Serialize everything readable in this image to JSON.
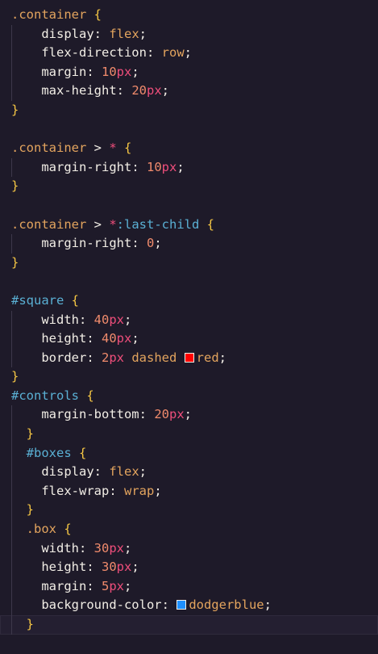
{
  "editor": {
    "colors": {
      "background": "#1e1a29",
      "selector": "#e3a45e",
      "id_selector": "#5ab0d4",
      "brace": "#f6c744",
      "property": "#f2eee6",
      "number": "#f08b6c",
      "unit": "#ef4e7b"
    },
    "lines": [
      {
        "tokens": [
          {
            "t": "sel",
            "v": ".container"
          },
          {
            "t": "punct",
            "v": " "
          },
          {
            "t": "brace",
            "v": "{"
          }
        ]
      },
      {
        "indent": 1,
        "tokens": [
          {
            "t": "prop",
            "v": "display"
          },
          {
            "t": "punct",
            "v": ": "
          },
          {
            "t": "kw",
            "v": "flex"
          },
          {
            "t": "punct",
            "v": ";"
          }
        ]
      },
      {
        "indent": 1,
        "tokens": [
          {
            "t": "prop",
            "v": "flex-direction"
          },
          {
            "t": "punct",
            "v": ": "
          },
          {
            "t": "kw",
            "v": "row"
          },
          {
            "t": "punct",
            "v": ";"
          }
        ]
      },
      {
        "indent": 1,
        "tokens": [
          {
            "t": "prop",
            "v": "margin"
          },
          {
            "t": "punct",
            "v": ": "
          },
          {
            "t": "num",
            "v": "10"
          },
          {
            "t": "unit",
            "v": "px"
          },
          {
            "t": "punct",
            "v": ";"
          }
        ]
      },
      {
        "indent": 1,
        "tokens": [
          {
            "t": "prop",
            "v": "max-height"
          },
          {
            "t": "punct",
            "v": ": "
          },
          {
            "t": "num",
            "v": "20"
          },
          {
            "t": "unit",
            "v": "px"
          },
          {
            "t": "punct",
            "v": ";"
          }
        ]
      },
      {
        "tokens": [
          {
            "t": "brace",
            "v": "}"
          }
        ]
      },
      {
        "tokens": []
      },
      {
        "tokens": [
          {
            "t": "sel",
            "v": ".container"
          },
          {
            "t": "op",
            "v": " > "
          },
          {
            "t": "star",
            "v": "*"
          },
          {
            "t": "punct",
            "v": " "
          },
          {
            "t": "brace",
            "v": "{"
          }
        ]
      },
      {
        "indent": 1,
        "tokens": [
          {
            "t": "prop",
            "v": "margin-right"
          },
          {
            "t": "punct",
            "v": ": "
          },
          {
            "t": "num",
            "v": "10"
          },
          {
            "t": "unit",
            "v": "px"
          },
          {
            "t": "punct",
            "v": ";"
          }
        ]
      },
      {
        "tokens": [
          {
            "t": "brace",
            "v": "}"
          }
        ]
      },
      {
        "tokens": []
      },
      {
        "tokens": [
          {
            "t": "sel",
            "v": ".container"
          },
          {
            "t": "op",
            "v": " > "
          },
          {
            "t": "star",
            "v": "*"
          },
          {
            "t": "pseudo",
            "v": ":last-child"
          },
          {
            "t": "punct",
            "v": " "
          },
          {
            "t": "brace",
            "v": "{"
          }
        ]
      },
      {
        "indent": 1,
        "tokens": [
          {
            "t": "prop",
            "v": "margin-right"
          },
          {
            "t": "punct",
            "v": ": "
          },
          {
            "t": "num",
            "v": "0"
          },
          {
            "t": "punct",
            "v": ";"
          }
        ]
      },
      {
        "tokens": [
          {
            "t": "brace",
            "v": "}"
          }
        ]
      },
      {
        "tokens": []
      },
      {
        "tokens": [
          {
            "t": "idsel",
            "v": "#square"
          },
          {
            "t": "punct",
            "v": " "
          },
          {
            "t": "brace",
            "v": "{"
          }
        ]
      },
      {
        "indent": 1,
        "tokens": [
          {
            "t": "prop",
            "v": "width"
          },
          {
            "t": "punct",
            "v": ": "
          },
          {
            "t": "num",
            "v": "40"
          },
          {
            "t": "unit",
            "v": "px"
          },
          {
            "t": "punct",
            "v": ";"
          }
        ]
      },
      {
        "indent": 1,
        "tokens": [
          {
            "t": "prop",
            "v": "height"
          },
          {
            "t": "punct",
            "v": ": "
          },
          {
            "t": "num",
            "v": "40"
          },
          {
            "t": "unit",
            "v": "px"
          },
          {
            "t": "punct",
            "v": ";"
          }
        ]
      },
      {
        "indent": 1,
        "tokens": [
          {
            "t": "prop",
            "v": "border"
          },
          {
            "t": "punct",
            "v": ": "
          },
          {
            "t": "num",
            "v": "2"
          },
          {
            "t": "unit",
            "v": "px"
          },
          {
            "t": "kw",
            "v": " dashed "
          },
          {
            "t": "swatch",
            "v": "#ff0000"
          },
          {
            "t": "kw",
            "v": "red"
          },
          {
            "t": "punct",
            "v": ";"
          }
        ]
      },
      {
        "tokens": [
          {
            "t": "brace",
            "v": "}"
          }
        ]
      },
      {
        "tokens": [
          {
            "t": "idsel",
            "v": "#controls"
          },
          {
            "t": "punct",
            "v": " "
          },
          {
            "t": "brace",
            "v": "{"
          }
        ]
      },
      {
        "indent": 1,
        "tokens": [
          {
            "t": "prop",
            "v": "margin-bottom"
          },
          {
            "t": "punct",
            "v": ": "
          },
          {
            "t": "num",
            "v": "20"
          },
          {
            "t": "unit",
            "v": "px"
          },
          {
            "t": "punct",
            "v": ";"
          }
        ]
      },
      {
        "nested": 1,
        "tokens": [
          {
            "t": "brace",
            "v": "}"
          }
        ]
      },
      {
        "nested": 1,
        "tokens": [
          {
            "t": "idsel",
            "v": "#boxes"
          },
          {
            "t": "punct",
            "v": " "
          },
          {
            "t": "brace",
            "v": "{"
          }
        ]
      },
      {
        "indent": 1,
        "tokens": [
          {
            "t": "prop",
            "v": "display"
          },
          {
            "t": "punct",
            "v": ": "
          },
          {
            "t": "kw",
            "v": "flex"
          },
          {
            "t": "punct",
            "v": ";"
          }
        ]
      },
      {
        "indent": 1,
        "tokens": [
          {
            "t": "prop",
            "v": "flex-wrap"
          },
          {
            "t": "punct",
            "v": ": "
          },
          {
            "t": "kw",
            "v": "wrap"
          },
          {
            "t": "punct",
            "v": ";"
          }
        ]
      },
      {
        "nested": 1,
        "tokens": [
          {
            "t": "brace",
            "v": "}"
          }
        ]
      },
      {
        "nested": 1,
        "tokens": [
          {
            "t": "sel",
            "v": ".box"
          },
          {
            "t": "punct",
            "v": " "
          },
          {
            "t": "brace",
            "v": "{"
          }
        ]
      },
      {
        "indent": 1,
        "tokens": [
          {
            "t": "prop",
            "v": "width"
          },
          {
            "t": "punct",
            "v": ": "
          },
          {
            "t": "num",
            "v": "30"
          },
          {
            "t": "unit",
            "v": "px"
          },
          {
            "t": "punct",
            "v": ";"
          }
        ]
      },
      {
        "indent": 1,
        "tokens": [
          {
            "t": "prop",
            "v": "height"
          },
          {
            "t": "punct",
            "v": ": "
          },
          {
            "t": "num",
            "v": "30"
          },
          {
            "t": "unit",
            "v": "px"
          },
          {
            "t": "punct",
            "v": ";"
          }
        ]
      },
      {
        "indent": 1,
        "tokens": [
          {
            "t": "prop",
            "v": "margin"
          },
          {
            "t": "punct",
            "v": ": "
          },
          {
            "t": "num",
            "v": "5"
          },
          {
            "t": "unit",
            "v": "px"
          },
          {
            "t": "punct",
            "v": ";"
          }
        ]
      },
      {
        "indent": 1,
        "tokens": [
          {
            "t": "prop",
            "v": "background-color"
          },
          {
            "t": "punct",
            "v": ": "
          },
          {
            "t": "swatch",
            "v": "#1e90ff"
          },
          {
            "t": "kw",
            "v": "dodgerblue"
          },
          {
            "t": "punct",
            "v": ";"
          }
        ]
      },
      {
        "nested": 1,
        "current": true,
        "tokens": [
          {
            "t": "brace",
            "v": "}"
          }
        ]
      }
    ]
  }
}
